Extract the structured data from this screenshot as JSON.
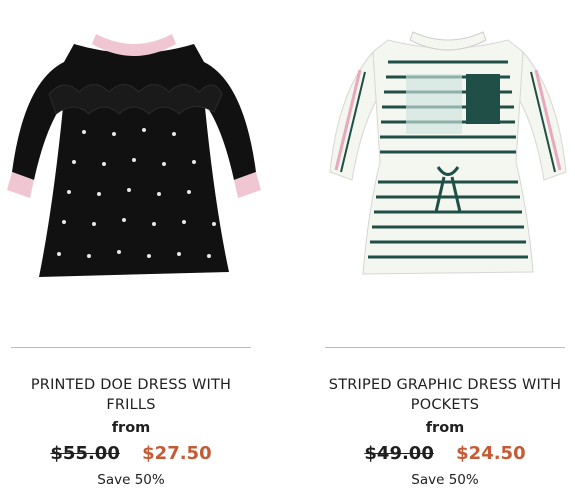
{
  "products": [
    {
      "title": "PRINTED DOE DRESS WITH FRILLS",
      "from_label": "from",
      "old_price": "$55.00",
      "new_price": "$27.50",
      "save_text": "Save 50%",
      "colors": {
        "dress": "#111111",
        "trim": "#f1c6d3",
        "print": "#ffffff"
      }
    },
    {
      "title": "STRIPED GRAPHIC DRESS WITH POCKETS",
      "from_label": "from",
      "old_price": "$49.00",
      "new_price": "$24.50",
      "save_text": "Save 50%",
      "colors": {
        "dress": "#f4f6f0",
        "stripe": "#1f4f46",
        "pocket": "#1f4f46",
        "sleeve_stripe": "#e8a8bd"
      }
    }
  ]
}
